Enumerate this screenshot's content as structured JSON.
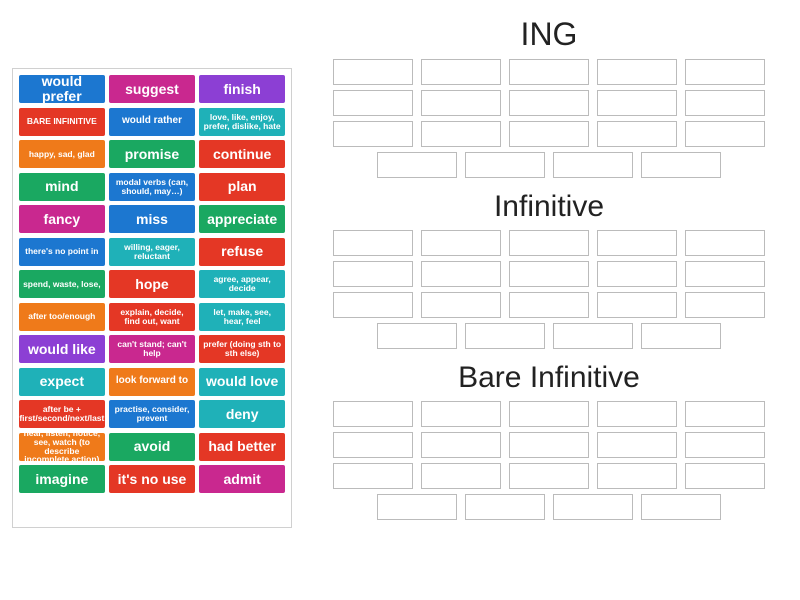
{
  "palette": {
    "cards": [
      {
        "label": "would prefer",
        "color": "#1c77d0",
        "size": "reg"
      },
      {
        "label": "suggest",
        "color": "#c9288f",
        "size": "reg"
      },
      {
        "label": "finish",
        "color": "#8c3fd4",
        "size": "reg"
      },
      {
        "label": "BARE INFINITIVE",
        "color": "#e43725",
        "size": "small"
      },
      {
        "label": "would rather",
        "color": "#1c77d0",
        "size": "med"
      },
      {
        "label": "love, like, enjoy, prefer, dislike, hate",
        "color": "#1fb1b8",
        "size": "small"
      },
      {
        "label": "happy, sad, glad",
        "color": "#ef7a1a",
        "size": "small"
      },
      {
        "label": "promise",
        "color": "#1aa861",
        "size": "reg"
      },
      {
        "label": "continue",
        "color": "#e43725",
        "size": "reg"
      },
      {
        "label": "mind",
        "color": "#1aa861",
        "size": "reg"
      },
      {
        "label": "modal verbs (can, should, may…)",
        "color": "#1c77d0",
        "size": "small"
      },
      {
        "label": "plan",
        "color": "#e43725",
        "size": "reg"
      },
      {
        "label": "fancy",
        "color": "#c9288f",
        "size": "reg"
      },
      {
        "label": "miss",
        "color": "#1c77d0",
        "size": "reg"
      },
      {
        "label": "appreciate",
        "color": "#1aa861",
        "size": "reg"
      },
      {
        "label": "there's no point in",
        "color": "#1c77d0",
        "size": "small"
      },
      {
        "label": "willing, eager, reluctant",
        "color": "#1fb1b8",
        "size": "small"
      },
      {
        "label": "refuse",
        "color": "#e43725",
        "size": "reg"
      },
      {
        "label": "spend, waste, lose,",
        "color": "#1aa861",
        "size": "small"
      },
      {
        "label": "hope",
        "color": "#e43725",
        "size": "reg"
      },
      {
        "label": "agree, appear, decide",
        "color": "#1fb1b8",
        "size": "small"
      },
      {
        "label": "after too/enough",
        "color": "#ef7a1a",
        "size": "small"
      },
      {
        "label": "explain, decide, find out, want",
        "color": "#e43725",
        "size": "small"
      },
      {
        "label": "let, make, see, hear, feel",
        "color": "#1fb1b8",
        "size": "small"
      },
      {
        "label": "would like",
        "color": "#8c3fd4",
        "size": "reg"
      },
      {
        "label": "can't stand; can't help",
        "color": "#c9288f",
        "size": "small"
      },
      {
        "label": "prefer (doing sth to sth else)",
        "color": "#e43725",
        "size": "small"
      },
      {
        "label": "expect",
        "color": "#1fb1b8",
        "size": "reg"
      },
      {
        "label": "look forward to",
        "color": "#ef7a1a",
        "size": "med"
      },
      {
        "label": "would love",
        "color": "#1fb1b8",
        "size": "reg"
      },
      {
        "label": "after be + first/second/next/last",
        "color": "#e43725",
        "size": "small"
      },
      {
        "label": "practise, consider, prevent",
        "color": "#1c77d0",
        "size": "small"
      },
      {
        "label": "deny",
        "color": "#1fb1b8",
        "size": "reg"
      },
      {
        "label": "hear, listen, notice, see, watch (to describe incomplete action)",
        "color": "#ef7a1a",
        "size": "small"
      },
      {
        "label": "avoid",
        "color": "#1aa861",
        "size": "reg"
      },
      {
        "label": "had better",
        "color": "#e43725",
        "size": "reg"
      },
      {
        "label": "imagine",
        "color": "#1aa861",
        "size": "reg"
      },
      {
        "label": "it's no use",
        "color": "#e43725",
        "size": "reg"
      },
      {
        "label": "admit",
        "color": "#c9288f",
        "size": "reg"
      }
    ]
  },
  "groups": [
    {
      "title": "ING",
      "rows": [
        5,
        5,
        5,
        4
      ]
    },
    {
      "title": "Infinitive",
      "rows": [
        5,
        5,
        5,
        4
      ]
    },
    {
      "title": "Bare Infinitive",
      "rows": [
        5,
        5,
        5,
        4
      ]
    }
  ]
}
